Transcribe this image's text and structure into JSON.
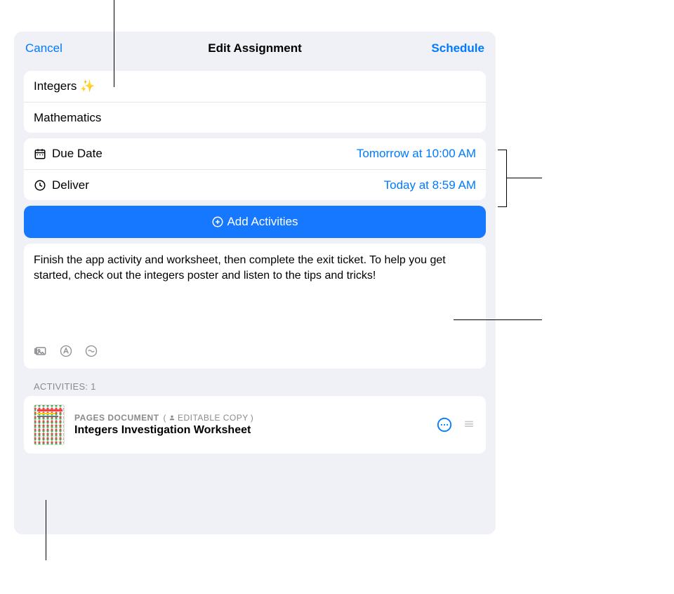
{
  "header": {
    "cancel": "Cancel",
    "title": "Edit Assignment",
    "schedule": "Schedule"
  },
  "assignment": {
    "title": "Integers ✨",
    "subject": "Mathematics"
  },
  "dates": {
    "due_label": "Due Date",
    "due_value": "Tomorrow at 10:00 AM",
    "deliver_label": "Deliver",
    "deliver_value": "Today at 8:59 AM"
  },
  "add_button": "Add Activities",
  "instructions": "Finish the app activity and worksheet, then complete the exit ticket. To help you get started, check out the integers poster and listen to the tips and tricks!",
  "activities_header": "ACTIVITIES: 1",
  "activity": {
    "type_label": "PAGES DOCUMENT",
    "editable_label": "EDITABLE COPY",
    "title": "Integers Investigation Worksheet"
  }
}
